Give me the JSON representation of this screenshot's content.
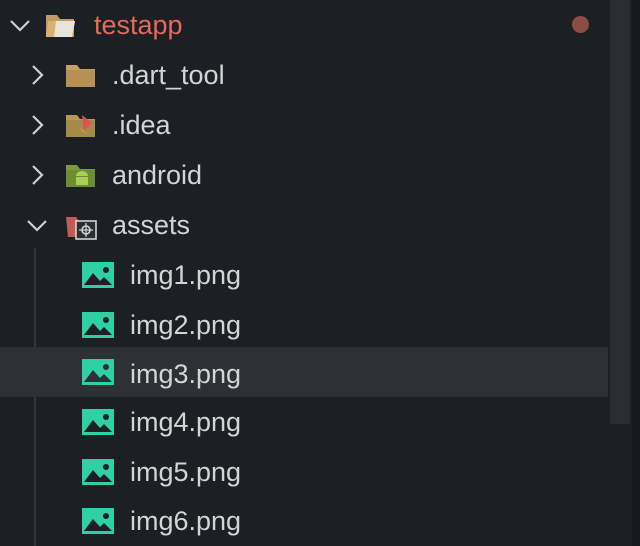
{
  "explorer": {
    "root": {
      "label": "testapp",
      "icon": "folder-open-icon",
      "expanded": true,
      "status_color": "#8d4d47"
    },
    "items": [
      {
        "label": ".dart_tool",
        "icon": "folder-icon",
        "expanded": false
      },
      {
        "label": ".idea",
        "icon": "idea-folder-icon",
        "expanded": false
      },
      {
        "label": "android",
        "icon": "android-folder-icon",
        "expanded": false
      },
      {
        "label": "assets",
        "icon": "assets-folder-icon",
        "expanded": true
      }
    ],
    "files": [
      {
        "label": "img1.png",
        "icon": "image-file-icon"
      },
      {
        "label": "img2.png",
        "icon": "image-file-icon"
      },
      {
        "label": "img3.png",
        "icon": "image-file-icon",
        "selected": true
      },
      {
        "label": "img4.png",
        "icon": "image-file-icon"
      },
      {
        "label": "img5.png",
        "icon": "image-file-icon"
      },
      {
        "label": "img6.png",
        "icon": "image-file-icon"
      }
    ]
  },
  "colors": {
    "background": "#1c1f23",
    "root_label": "#e5695c",
    "text": "#d4d4d4",
    "selection": "#2d3035",
    "image_icon": "#2fd0a5"
  }
}
